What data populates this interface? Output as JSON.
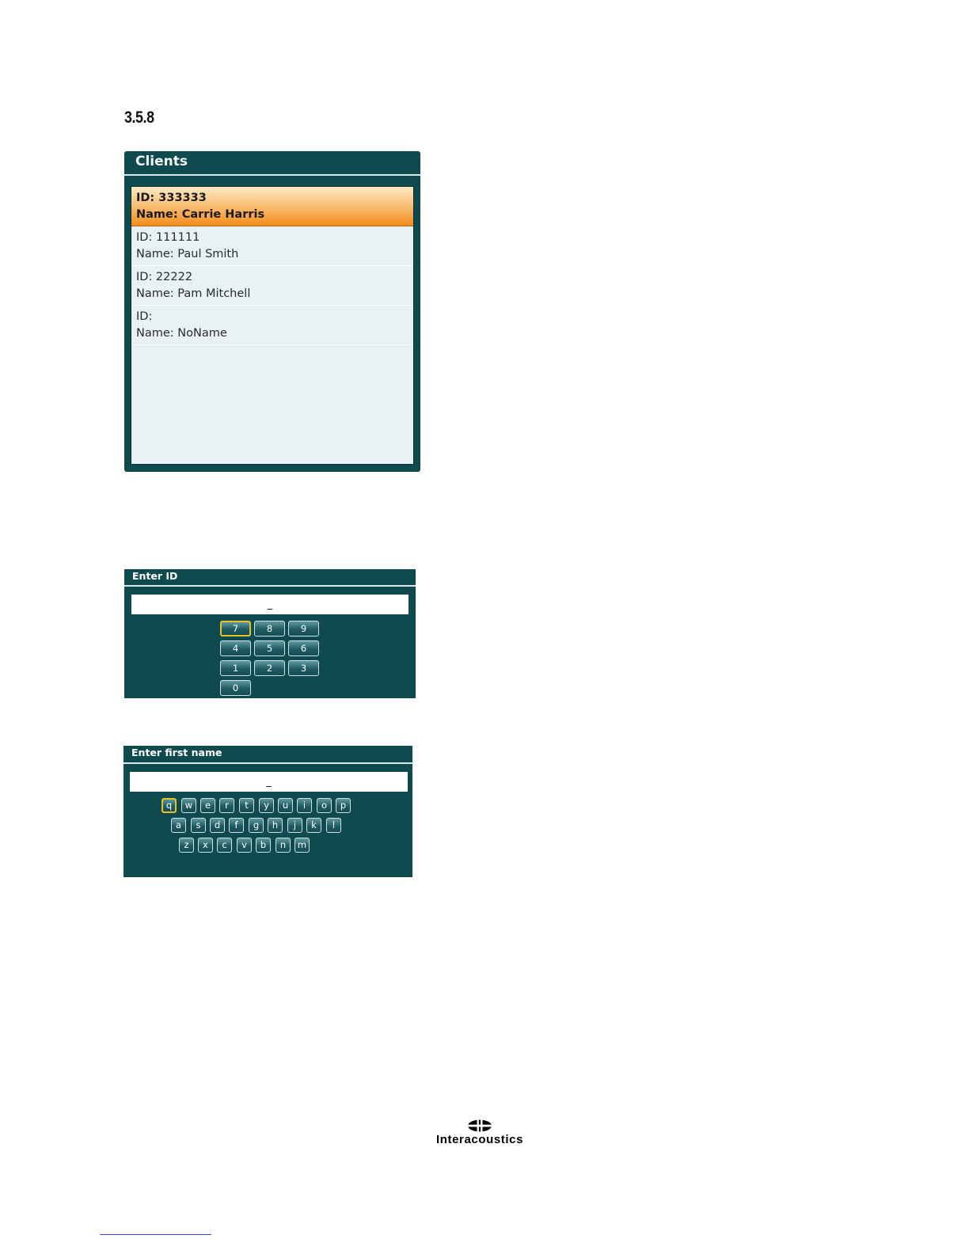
{
  "section_number": "3.5.8",
  "clients_panel": {
    "title": "Clients",
    "items": [
      {
        "id_line": "ID: 333333",
        "name_line": "Name: Carrie Harris",
        "selected": true
      },
      {
        "id_line": "ID: 111111",
        "name_line": "Name: Paul Smith",
        "selected": false
      },
      {
        "id_line": "ID: 22222",
        "name_line": "Name: Pam Mitchell",
        "selected": false
      },
      {
        "id_line": "ID:",
        "name_line": "Name: NoName",
        "selected": false
      }
    ]
  },
  "enter_id": {
    "title": "Enter ID",
    "field_value": "_",
    "keys": [
      "7",
      "8",
      "9",
      "4",
      "5",
      "6",
      "1",
      "2",
      "3",
      "0"
    ],
    "focused_key": "7"
  },
  "enter_first_name": {
    "title": "Enter first name",
    "field_value": "_",
    "rows": [
      [
        "q",
        "w",
        "e",
        "r",
        "t",
        "y",
        "u",
        "i",
        "o",
        "p"
      ],
      [
        "a",
        "s",
        "d",
        "f",
        "g",
        "h",
        "j",
        "k",
        "l"
      ],
      [
        "z",
        "x",
        "c",
        "v",
        "b",
        "n",
        "m"
      ]
    ],
    "focused_key": "q"
  },
  "logo": {
    "text": "Interacoustics",
    "icon": "interacoustics-logo-icon"
  },
  "colors": {
    "panel_bg": "#0f4a4f",
    "list_bg": "#e8f2f5",
    "selected_row": "#f48e1c",
    "focus_border": "#e6c229",
    "footer_rule": "#2b4fd6"
  }
}
